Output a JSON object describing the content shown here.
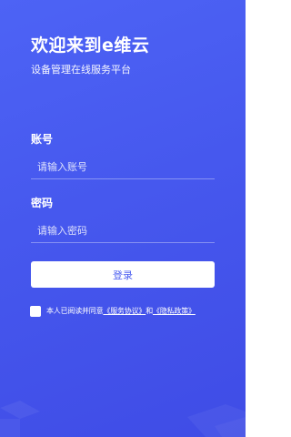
{
  "header": {
    "title": "欢迎来到e维云",
    "subtitle": "设备管理在线服务平台"
  },
  "form": {
    "account": {
      "label": "账号",
      "placeholder": "请输入账号",
      "value": ""
    },
    "password": {
      "label": "密码",
      "placeholder": "请输入密码",
      "value": ""
    },
    "login_label": "登录"
  },
  "agreement": {
    "checked": false,
    "prefix": "本人已阅读并同意",
    "service_link": "《服务协议》",
    "conjunction": "和",
    "privacy_link": "《隐私政策》"
  },
  "colors": {
    "background_start": "#4d63f5",
    "background_end": "#3f4ce6",
    "button_text": "#4a5df0",
    "text": "#ffffff"
  }
}
